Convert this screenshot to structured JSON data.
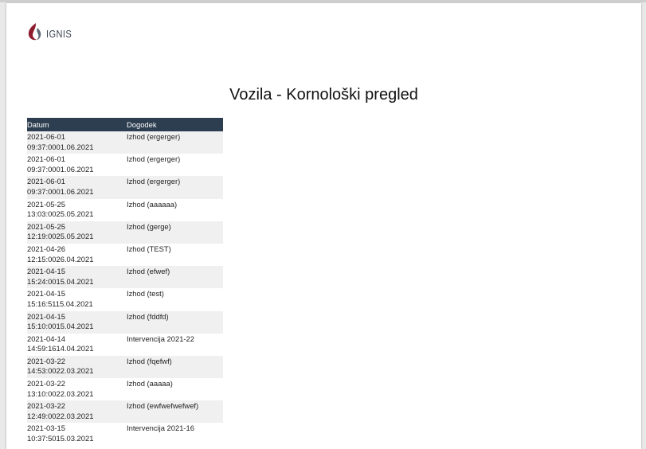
{
  "logo": {
    "text": "IGNIS"
  },
  "document": {
    "title": "Vozila - Kornološki pregled"
  },
  "table": {
    "headers": [
      "Datum",
      "Dogodek"
    ],
    "rows": [
      {
        "date": "2021-06-01",
        "time": "09:37:0001.06.2021",
        "event": "Izhod (ergerger)"
      },
      {
        "date": "2021-06-01",
        "time": "09:37:0001.06.2021",
        "event": "Izhod (ergerger)"
      },
      {
        "date": "2021-06-01",
        "time": "09:37:0001.06.2021",
        "event": "Izhod (ergerger)"
      },
      {
        "date": "2021-05-25",
        "time": "13:03:0025.05.2021",
        "event": "Izhod (aaaaaa)"
      },
      {
        "date": "2021-05-25",
        "time": "12:19:0025.05.2021",
        "event": "Izhod (gerge)"
      },
      {
        "date": "2021-04-26",
        "time": "12:15:0026.04.2021",
        "event": "Izhod (TEST)"
      },
      {
        "date": "2021-04-15",
        "time": "15:24:0015.04.2021",
        "event": "Izhod (efwef)"
      },
      {
        "date": "2021-04-15",
        "time": "15:16:5115.04.2021",
        "event": "Izhod (test)"
      },
      {
        "date": "2021-04-15",
        "time": "15:10:0015.04.2021",
        "event": "Izhod (fddfd)"
      },
      {
        "date": "2021-04-14",
        "time": "14:59:1614.04.2021",
        "event": "Intervencija 2021-22"
      },
      {
        "date": "2021-03-22",
        "time": "14:53:0022.03.2021",
        "event": "Izhod (fqefwf)"
      },
      {
        "date": "2021-03-22",
        "time": "13:10:0022.03.2021",
        "event": "Izhod (aaaaa)"
      },
      {
        "date": "2021-03-22",
        "time": "12:49:0022.03.2021",
        "event": "Izhod (ewfwefwefwef)"
      },
      {
        "date": "2021-03-15",
        "time": "10:37:5015.03.2021",
        "event": "Intervencija 2021-16"
      }
    ]
  },
  "colors": {
    "header_bg": "#2d3e50",
    "row_alt": "#f0f0f0",
    "logo_red": "#8e1b2e"
  }
}
